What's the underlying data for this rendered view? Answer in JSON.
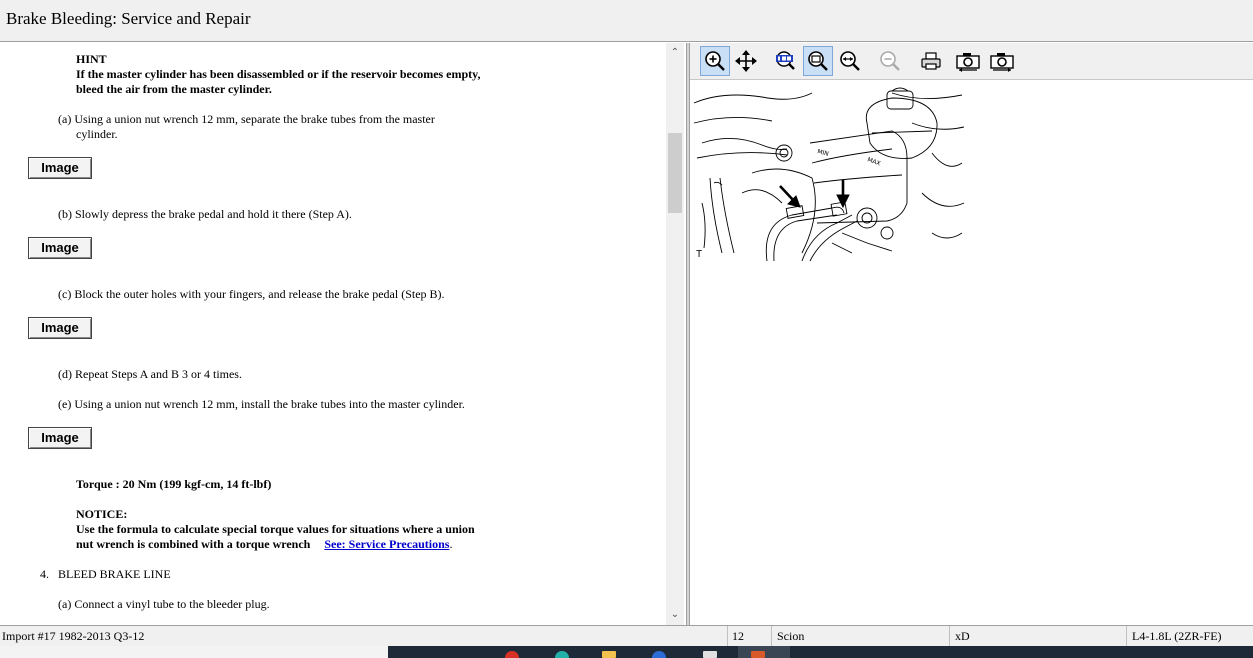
{
  "window": {
    "title": "Brake Bleeding:  Service and Repair"
  },
  "content": {
    "hint_heading": "HINT",
    "hint_line1": "If the master cylinder has been disassembled or if the reservoir becomes empty,",
    "hint_line2": "bleed the air from the master cylinder.",
    "step_a_line1": "(a) Using a union nut wrench 12 mm, separate the brake tubes from the master",
    "step_a_line2": "cylinder.",
    "step_b": "(b) Slowly depress the brake pedal and hold it there (Step A).",
    "step_c": "(c) Block the outer holes with your fingers, and release the brake pedal (Step B).",
    "step_d": "(d) Repeat Steps A and B 3 or 4 times.",
    "step_e": "(e) Using a union nut wrench 12 mm, install the brake tubes into the master cylinder.",
    "image_button_label": "Image",
    "torque": "Torque : 20 Nm (199 kgf-cm, 14 ft-lbf)",
    "notice_heading": "NOTICE:",
    "notice_line1": "Use the formula to calculate special torque values for situations where a union",
    "notice_line2": "nut wrench is combined with a torque wrench",
    "notice_link": "See: Service Precautions",
    "notice_period": ".",
    "section4": "4.   BLEED BRAKE LINE",
    "section4_a": "(a) Connect a vinyl tube to the bleeder plug."
  },
  "scrollbar": {
    "up_arrow": "⌃",
    "down_arrow": "⌄"
  },
  "toolbar": {
    "buttons": [
      "zoom-in",
      "pan",
      "zoom-100",
      "zoom-fit",
      "zoom-width",
      "zoom-out",
      "print",
      "copy-image",
      "export-image"
    ],
    "active": [
      "zoom-in",
      "zoom-fit"
    ],
    "active_color": "#c9dff5"
  },
  "diagram": {
    "label": "T"
  },
  "statusbar": {
    "source": "Import #17 1982-2013 Q3-12",
    "year": "12",
    "make": "Scion",
    "model": "xD",
    "engine": "L4-1.8L (2ZR-FE)"
  }
}
